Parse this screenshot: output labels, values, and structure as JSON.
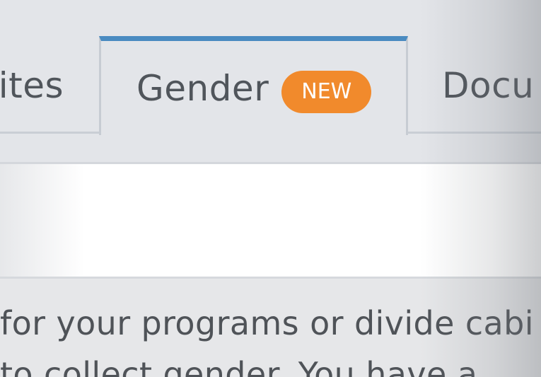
{
  "tabs": [
    {
      "label": "Sites"
    },
    {
      "label": "Gender",
      "badge": "NEW"
    },
    {
      "label": "Docu"
    }
  ],
  "body": {
    "line1": "for your programs or divide cabi",
    "line2": "to collect gender. You have a"
  },
  "colors": {
    "active_tab_accent": "#4a8bc1",
    "badge_bg": "#f18a2c",
    "badge_text": "#ffffff",
    "tab_text": "#50555b"
  }
}
